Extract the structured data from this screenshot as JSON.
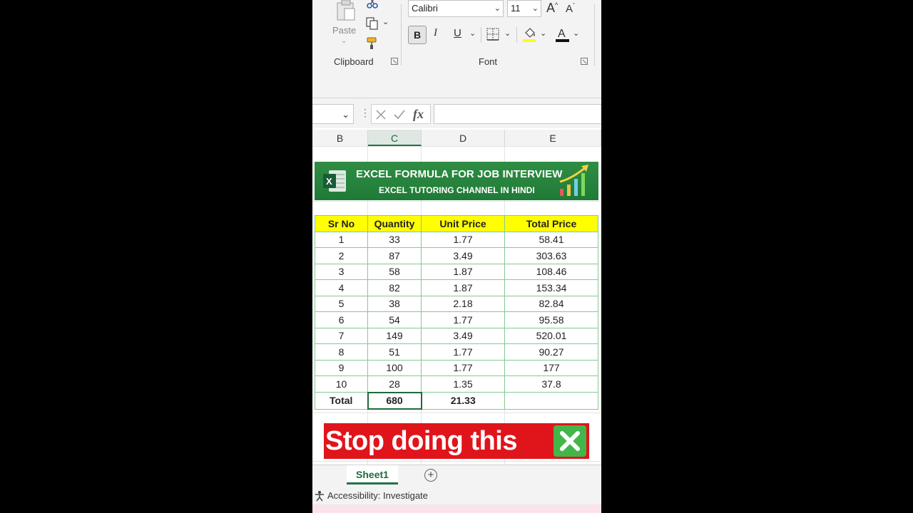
{
  "ribbon": {
    "clipboard": {
      "paste_label": "Paste",
      "group_label": "Clipboard"
    },
    "font": {
      "font_name": "Calibri",
      "font_size": "11",
      "group_label": "Font",
      "bold": "B",
      "italic": "I",
      "underline": "U"
    },
    "font_color_underline": "#e01010",
    "highlight_color": "#ffff00"
  },
  "formula_bar": {
    "fx_label": "fx",
    "value": ""
  },
  "columns": [
    "B",
    "C",
    "D",
    "E"
  ],
  "selected_column": "C",
  "banner": {
    "title": "EXCEL FORMULA FOR JOB INTERVIEW",
    "subtitle": "EXCEL TUTORING CHANNEL IN HINDI"
  },
  "table": {
    "headers": [
      "Sr No",
      "Quantity",
      "Unit Price",
      "Total Price"
    ],
    "rows": [
      [
        "1",
        "33",
        "1.77",
        "58.41"
      ],
      [
        "2",
        "87",
        "3.49",
        "303.63"
      ],
      [
        "3",
        "58",
        "1.87",
        "108.46"
      ],
      [
        "4",
        "82",
        "1.87",
        "153.34"
      ],
      [
        "5",
        "38",
        "2.18",
        "82.84"
      ],
      [
        "6",
        "54",
        "1.77",
        "95.58"
      ],
      [
        "7",
        "149",
        "3.49",
        "520.01"
      ],
      [
        "8",
        "51",
        "1.77",
        "90.27"
      ],
      [
        "9",
        "100",
        "1.77",
        "177"
      ],
      [
        "10",
        "28",
        "1.35",
        "37.8"
      ]
    ],
    "total": [
      "Total",
      "680",
      "21.33",
      ""
    ]
  },
  "caption": {
    "text": "Stop doing this"
  },
  "sheet_tabs": [
    {
      "label": "Sheet1",
      "active": true
    }
  ],
  "status": {
    "accessibility": "Accessibility: Investigate"
  },
  "colors": {
    "excel_green": "#217346",
    "header_yellow": "#ffff00",
    "caption_red": "#e0141b",
    "banner_green": "#1f7a37"
  }
}
